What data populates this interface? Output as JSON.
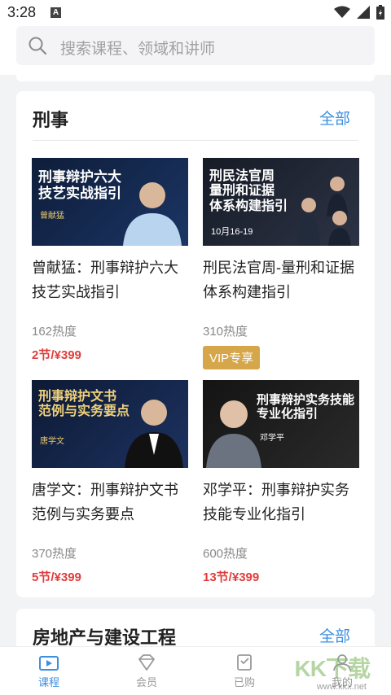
{
  "status": {
    "time": "3:28",
    "a_label": "A"
  },
  "search": {
    "placeholder": "搜索课程、领域和讲师"
  },
  "section": {
    "title": "刑事",
    "more": "全部",
    "courses": [
      {
        "thumb_title": "刑事辩护六大\n技艺实战指引",
        "thumb_name": "曾献猛",
        "title": "曾献猛：刑事辩护六大技艺实战指引",
        "heat": "162热度",
        "price": "2节/¥399",
        "vip": ""
      },
      {
        "thumb_title": "刑民法官周\n量刑和证据\n体系构建指引",
        "thumb_name": "10月16-19",
        "title": "刑民法官周-量刑和证据体系构建指引",
        "heat": "310热度",
        "price": "",
        "vip": "VIP专享"
      },
      {
        "thumb_title": "刑事辩护文书\n范例与实务要点",
        "thumb_name": "唐学文",
        "title": "唐学文：刑事辩护文书范例与实务要点",
        "heat": "370热度",
        "price": "5节/¥399",
        "vip": ""
      },
      {
        "thumb_title": "刑事辩护实务技能\n专业化指引",
        "thumb_name": "邓学平",
        "title": "邓学平：刑事辩护实务技能专业化指引",
        "heat": "600热度",
        "price": "13节/¥399",
        "vip": ""
      }
    ]
  },
  "section2": {
    "title": "房地产与建设工程",
    "more": "全部"
  },
  "tabs": [
    {
      "label": "课程",
      "icon": "video-icon",
      "active": true
    },
    {
      "label": "会员",
      "icon": "diamond-icon",
      "active": false
    },
    {
      "label": "已购",
      "icon": "purchased-icon",
      "active": false
    },
    {
      "label": "我的",
      "icon": "profile-icon",
      "active": false
    }
  ],
  "watermark": {
    "text": "KK下载",
    "url": "www.kkx.net"
  },
  "colors": {
    "accent": "#3d8fe0",
    "price": "#e23c3c",
    "vip": "#d6a64a"
  }
}
